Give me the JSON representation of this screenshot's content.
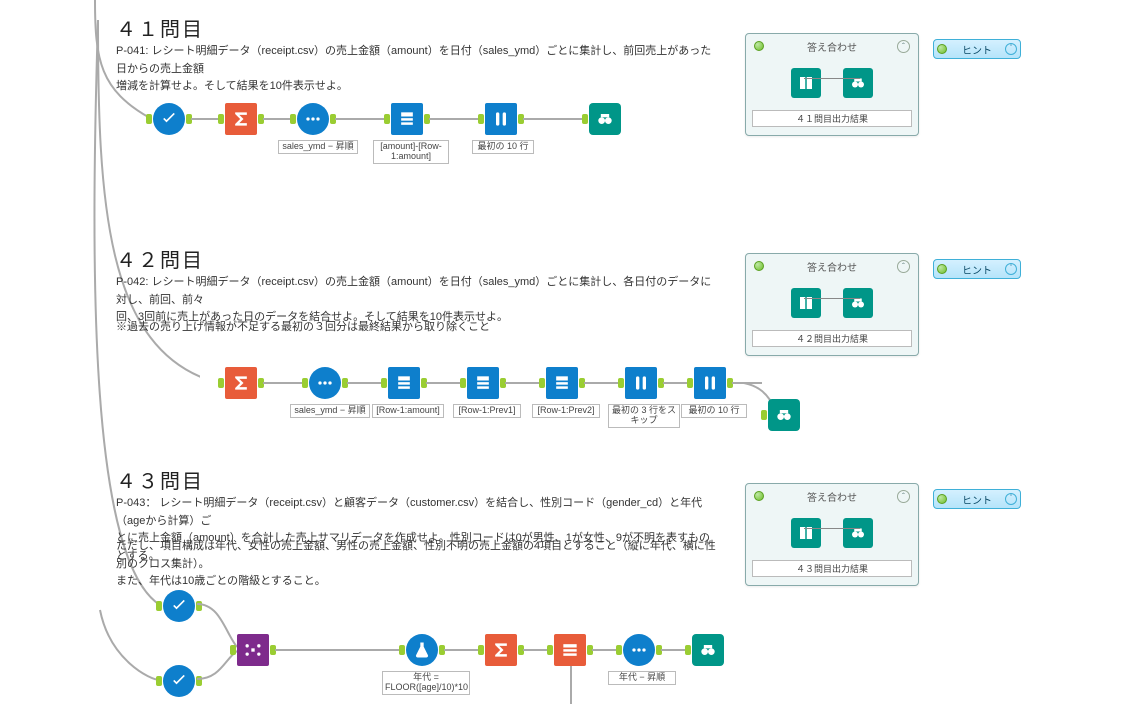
{
  "sections": {
    "s1": {
      "heading": "４１問目",
      "p041_line1": "P-041: レシート明細データ（receipt.csv）の売上金額（amount）を日付（sales_ymd）ごとに集計し、前回売上があった日からの売上金額",
      "p041_line2": "増減を計算せよ。そして結果を10件表示せよ。",
      "labels": {
        "sort": "sales_ymd − 昇順",
        "multirow": "[amount]-[Row-1:amount]",
        "head10": "最初の 10 行"
      }
    },
    "s2": {
      "heading": "４２問目",
      "p042_line1": "P-042: レシート明細データ（receipt.csv）の売上金額（amount）を日付（sales_ymd）ごとに集計し、各日付のデータに対し、前回、前々",
      "p042_line2": "回、3回前に売上があった日のデータを結合せよ。そして結果を10件表示せよ。",
      "p042_note": "※過去の売り上げ情報が不足する最初の３回分は最終結果から取り除くこと",
      "labels": {
        "sort": "sales_ymd − 昇順",
        "mr1": "[Row-1:amount]",
        "mr2": "[Row-1:Prev1]",
        "mr3": "[Row-1:Prev2]",
        "skip3": "最初の 3 行をスキップ",
        "head10": "最初の 10 行"
      }
    },
    "s3": {
      "heading": "４３問目",
      "p043_line1": "P-043： レシート明細データ（receipt.csv）と顧客データ（customer.csv）を結合し、性別コード（gender_cd）と年代（ageから計算）ご",
      "p043_line2": "とに売上金額（amount）を合計した売上サマリデータを作成せよ。性別コードは0が男性、1が女性、9が不明を表すものとする。",
      "p043_line3": "ただし、項目構成は年代、女性の売上金額、男性の売上金額、性別不明の売上金額の4項目とすること（縦に年代、横に性別のクロス集計）。",
      "p043_line4": "また、年代は10歳ごとの階級とすること。",
      "labels": {
        "floor": "年代 = FLOOR([age]/10)*10",
        "sort": "年代 − 昇順"
      }
    }
  },
  "panel": {
    "title": "答え合わせ",
    "cap1": "４１問目出力結果",
    "cap2": "４２問目出力結果",
    "cap3": "４３問目出力結果"
  },
  "hint_label": "ヒント"
}
